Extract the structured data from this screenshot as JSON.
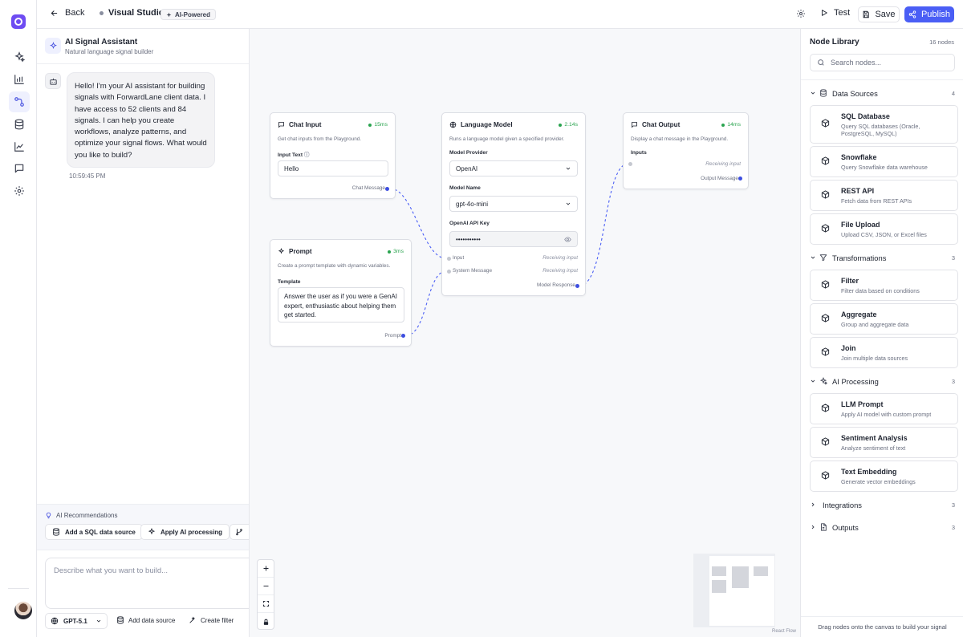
{
  "topbar": {
    "back": "Back",
    "title": "Visual Studio",
    "badge": "AI-Powered",
    "test": "Test",
    "save": "Save",
    "publish": "Publish",
    "colors": {
      "primary": "#4a5ef5",
      "brand": "#6e4cf2"
    }
  },
  "rail": {
    "items": [
      {
        "icon": "sparkles-icon"
      },
      {
        "icon": "bar-chart-icon"
      },
      {
        "icon": "workflow-icon",
        "active": true
      },
      {
        "icon": "database-icon"
      },
      {
        "icon": "line-chart-icon"
      },
      {
        "icon": "chat-icon"
      },
      {
        "icon": "settings-icon"
      }
    ]
  },
  "chat": {
    "title": "AI Signal Assistant",
    "subtitle": "Natural language signal builder",
    "message": "Hello! I'm your AI assistant for building signals with ForwardLane client data. I have access to 52 clients and 84 signals. I can help you create workflows, analyze patterns, and optimize your signal flows. What would you like to build?",
    "time": "10:59:45 PM",
    "recs_label": "AI Recommendations",
    "recs": [
      "Add a SQL data source",
      "Apply AI processing"
    ],
    "input_placeholder": "Describe what you want to build...",
    "model": "GPT-5.1",
    "actions": [
      "Add data source",
      "Create filter"
    ]
  },
  "canvas": {
    "nodes": {
      "chat_input": {
        "title": "Chat Input",
        "time": "15ms",
        "desc": "Get chat inputs from the Playground.",
        "field_label": "Input Text",
        "value": "Hello",
        "output": "Chat Message"
      },
      "prompt": {
        "title": "Prompt",
        "time": "3ms",
        "desc": "Create a prompt template with dynamic variables.",
        "field_label": "Template",
        "template": "Answer the user as if you were a GenAI expert, enthusiastic about helping them get started.",
        "output": "Prompt"
      },
      "llm": {
        "title": "Language Model",
        "time": "2.14s",
        "desc": "Runs a language model given a specified provider.",
        "provider_label": "Model Provider",
        "provider": "OpenAI",
        "model_label": "Model Name",
        "model": "gpt-4o-mini",
        "key_label": "OpenAI API Key",
        "key": "•••••••••••",
        "in1": "Input",
        "in2": "System Message",
        "receiving": "Receiving input",
        "output": "Model Response"
      },
      "chat_output": {
        "title": "Chat Output",
        "time": "14ms",
        "desc": "Display a chat message in the Playground.",
        "inputs_label": "Inputs",
        "receiving": "Receiving input",
        "output": "Output Message"
      }
    },
    "attribution": "React Flow"
  },
  "library": {
    "title": "Node Library",
    "count": "16 nodes",
    "search_placeholder": "Search nodes...",
    "categories": [
      {
        "name": "Data Sources",
        "count": "4",
        "expanded": true,
        "icon": "database-icon",
        "items": [
          {
            "name": "SQL Database",
            "desc": "Query SQL databases (Oracle, PostgreSQL, MySQL)"
          },
          {
            "name": "Snowflake",
            "desc": "Query Snowflake data warehouse"
          },
          {
            "name": "REST API",
            "desc": "Fetch data from REST APIs"
          },
          {
            "name": "File Upload",
            "desc": "Upload CSV, JSON, or Excel files"
          }
        ]
      },
      {
        "name": "Transformations",
        "count": "3",
        "expanded": true,
        "icon": "filter-icon",
        "items": [
          {
            "name": "Filter",
            "desc": "Filter data based on conditions"
          },
          {
            "name": "Aggregate",
            "desc": "Group and aggregate data"
          },
          {
            "name": "Join",
            "desc": "Join multiple data sources"
          }
        ]
      },
      {
        "name": "AI Processing",
        "count": "3",
        "expanded": true,
        "icon": "sparkles-icon",
        "items": [
          {
            "name": "LLM Prompt",
            "desc": "Apply AI model with custom prompt"
          },
          {
            "name": "Sentiment Analysis",
            "desc": "Analyze sentiment of text"
          },
          {
            "name": "Text Embedding",
            "desc": "Generate vector embeddings"
          }
        ]
      },
      {
        "name": "Integrations",
        "count": "3",
        "expanded": false
      },
      {
        "name": "Outputs",
        "count": "3",
        "expanded": false,
        "icon": "file-icon"
      }
    ],
    "footer": "Drag nodes onto the canvas to build your signal"
  }
}
